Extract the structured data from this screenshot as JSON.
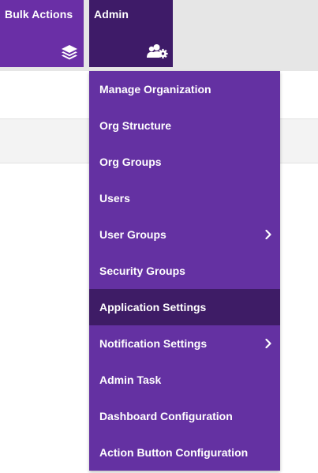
{
  "toolbar": {
    "bulk_actions": {
      "label": "Bulk Actions",
      "icon": "layers-icon"
    },
    "admin": {
      "label": "Admin",
      "icon": "users-gear-icon"
    }
  },
  "admin_menu": {
    "items": [
      {
        "label": "Manage Organization",
        "has_submenu": false,
        "active": false
      },
      {
        "label": "Org Structure",
        "has_submenu": false,
        "active": false
      },
      {
        "label": "Org Groups",
        "has_submenu": false,
        "active": false
      },
      {
        "label": "Users",
        "has_submenu": false,
        "active": false
      },
      {
        "label": "User Groups",
        "has_submenu": true,
        "active": false
      },
      {
        "label": "Security Groups",
        "has_submenu": false,
        "active": false
      },
      {
        "label": "Application Settings",
        "has_submenu": false,
        "active": true
      },
      {
        "label": "Notification Settings",
        "has_submenu": true,
        "active": false
      },
      {
        "label": "Admin Task",
        "has_submenu": false,
        "active": false
      },
      {
        "label": "Dashboard Configuration",
        "has_submenu": false,
        "active": false
      },
      {
        "label": "Action Button Configuration",
        "has_submenu": false,
        "active": false
      }
    ]
  },
  "colors": {
    "tile_purple": "#6a2fa6",
    "tile_active": "#3e1b68",
    "menu_bg": "#6431a2",
    "menu_item_active": "#3e1c66",
    "text": "#ffffff",
    "toolbar_bg": "#e6e6e6"
  }
}
